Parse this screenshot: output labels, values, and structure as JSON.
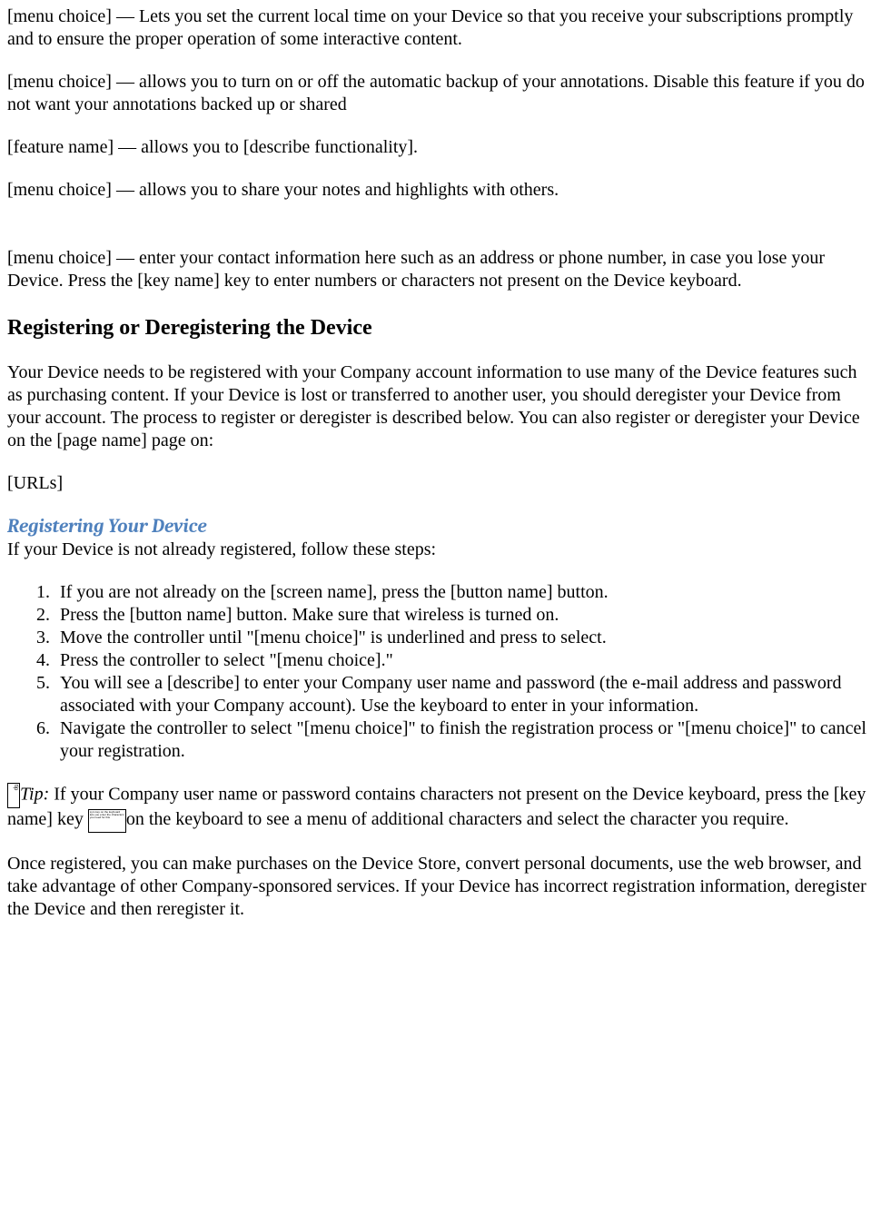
{
  "intro": {
    "p1": "[menu choice] — Lets you set the current local time on your Device so that you receive your subscriptions promptly and to ensure the proper operation of some interactive content.",
    "p2": "[menu choice] — allows you to turn on or off the automatic backup of your annotations. Disable this feature if you do not want your annotations backed up or shared",
    "p3": "[feature name] — allows you to [describe functionality].",
    "p4": "[menu choice] — allows you to share your notes and highlights with others.",
    "p5": "[menu choice] — enter your contact information here such as an address or phone number, in case you lose your Device. Press the [key name] key to enter numbers or characters not present on the Device keyboard."
  },
  "registering": {
    "heading": "Registering or Deregistering the Device",
    "p1": "Your Device needs to be registered with your Company account information to use many of the Device features such as purchasing content. If your Device is lost or transferred to another user, you should deregister your Device from your account. The process to register or deregister is described below. You can also register or deregister your Device on the [page name] page on:",
    "urls": "[URLs]",
    "subhead": "Registering Your Device",
    "subhead_after": "If your Device is not already registered, follow these steps:",
    "steps": [
      "If you are not already on the [screen name], press the [button name] button.",
      "Press the [button name] button. Make sure that wireless is turned on.",
      "Move the controller until \"[menu choice]\" is underlined and press to select.",
      "Press the controller to select \"[menu choice].\"",
      "You will see a [describe] to enter your Company user name and password (the e-mail address and password associated with your Company account). Use the keyboard to enter in your information.",
      "Navigate the controller to select \"[menu choice]\" to finish the registration process or \"[menu choice]\" to cancel your registration."
    ],
    "tip_label": "Tip:",
    "tip_before_key": " If your Company user name or password contains characters not present on the Device keyboard, press the [key name] key ",
    "tip_after_key": "on the keyboard to see a menu of additional characters and select the character you require.",
    "p_after_tip": "Once registered, you can make purchases on the Device Store, convert personal documents, use the web browser, and take advantage of other Company-sponsored services. If your Device has incorrect registration information, deregister the Device and then reregister it."
  }
}
